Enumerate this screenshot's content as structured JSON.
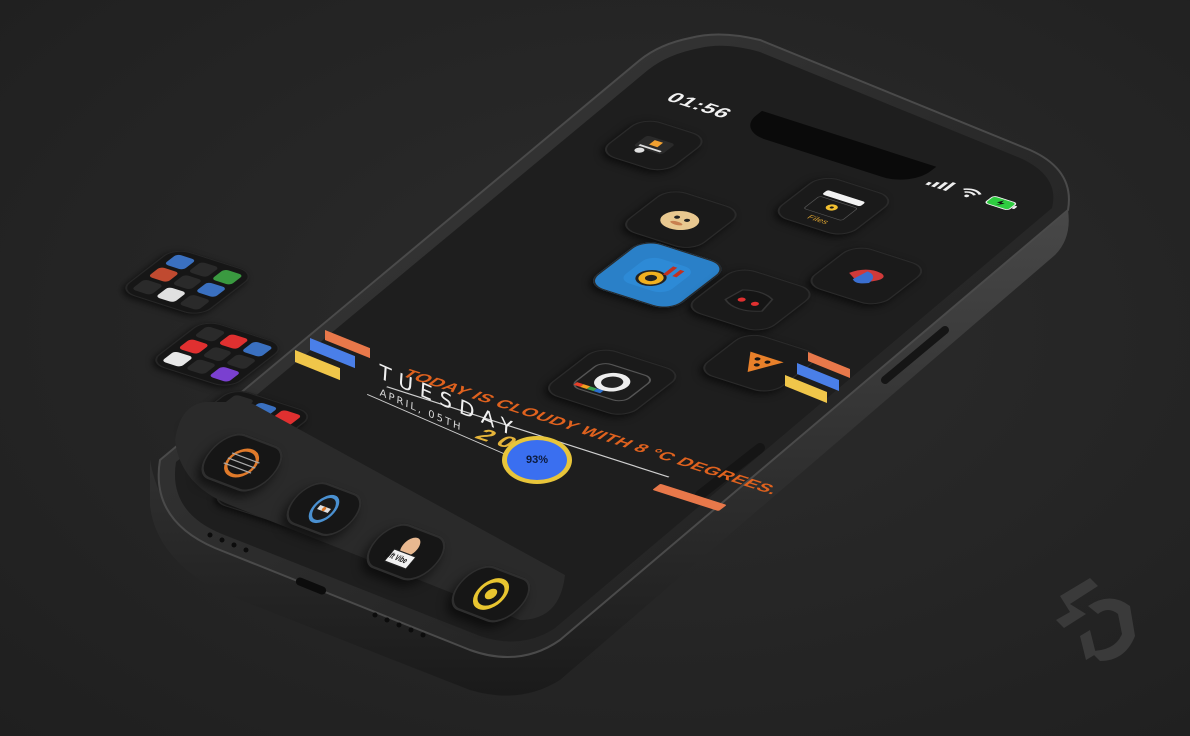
{
  "status_bar": {
    "time": "01:56"
  },
  "apps": [
    {
      "name": "app-top-1",
      "label": ""
    },
    {
      "name": "app-ghost",
      "label": ""
    },
    {
      "name": "app-files",
      "label": "Files"
    },
    {
      "name": "app-horn",
      "label": ""
    },
    {
      "name": "app-red-blue",
      "label": ""
    },
    {
      "name": "app-discord",
      "label": ""
    },
    {
      "name": "app-pizza",
      "label": ""
    },
    {
      "name": "app-camera",
      "label": ""
    }
  ],
  "weather_widget": {
    "text": "TODAY IS CLOUDY WITH 8 °C DEGREES.",
    "year": "2022"
  },
  "date_widget": {
    "day": "TUESDAY",
    "date": "APRIL, 05TH"
  },
  "battery_widget": {
    "percent_label": "93%",
    "percent": 93
  },
  "colors": {
    "stripe_orange": "#e8784a",
    "stripe_blue": "#4a7fe8",
    "stripe_yellow": "#f0c64a",
    "accent_orange": "#e0621e",
    "accent_yellow": "#e5b43a",
    "battery_fill": "#3a6ff0",
    "battery_ring": "#e8c53a"
  },
  "dock": {
    "items": [
      {
        "name": "dock-guitar",
        "label": ""
      },
      {
        "name": "dock-compass",
        "label": ""
      },
      {
        "name": "dock-sticker",
        "label": "Lift Vibe"
      },
      {
        "name": "dock-ring",
        "label": ""
      }
    ]
  }
}
